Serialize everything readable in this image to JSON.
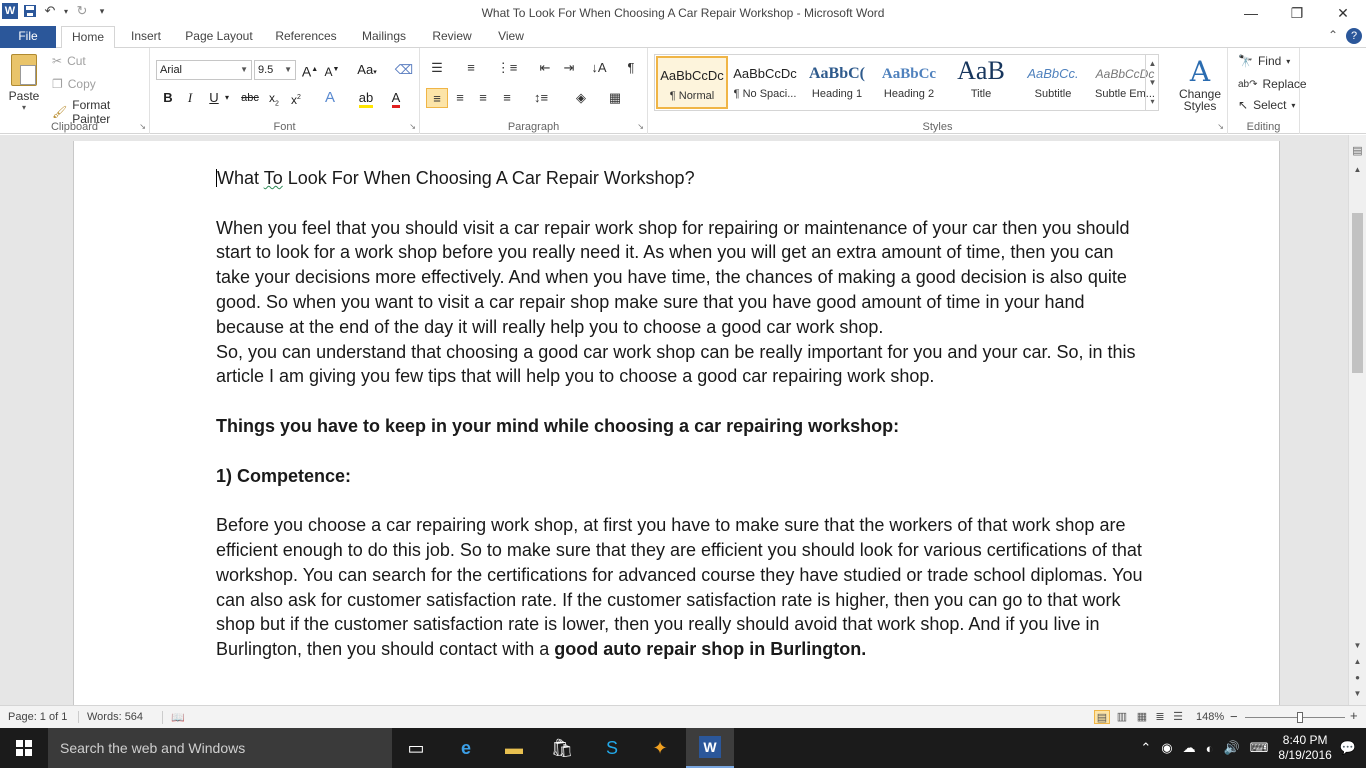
{
  "window": {
    "title": "What To Look For When Choosing A Car Repair Workshop  -  Microsoft Word",
    "app_icon": "W"
  },
  "ribbon_tabs": [
    "File",
    "Home",
    "Insert",
    "Page Layout",
    "References",
    "Mailings",
    "Review",
    "View"
  ],
  "active_tab": "Home",
  "clipboard": {
    "paste": "Paste",
    "cut": "Cut",
    "copy": "Copy",
    "format_painter": "Format Painter",
    "label": "Clipboard"
  },
  "font": {
    "name": "Arial",
    "size": "9.5",
    "label": "Font"
  },
  "paragraph": {
    "label": "Paragraph"
  },
  "styles": {
    "items": [
      {
        "sample": "AaBbCcDc",
        "name": "¶ Normal"
      },
      {
        "sample": "AaBbCcDc",
        "name": "¶ No Spaci..."
      },
      {
        "sample": "AaBbC(",
        "name": "Heading 1"
      },
      {
        "sample": "AaBbCc",
        "name": "Heading 2"
      },
      {
        "sample": "AaB",
        "name": "Title"
      },
      {
        "sample": "AaBbCc.",
        "name": "Subtitle"
      },
      {
        "sample": "AaBbCcDc",
        "name": "Subtle Em..."
      }
    ],
    "change_styles": "Change Styles",
    "label": "Styles"
  },
  "editing": {
    "find": "Find",
    "replace": "Replace",
    "select": "Select",
    "label": "Editing"
  },
  "document": {
    "title_line": "What To Look For When Choosing A Car Repair Workshop?",
    "title_prefix": "What ",
    "title_squiggle": "To",
    "title_rest": " Look For When Choosing A Car Repair Workshop?",
    "para1": "When you feel that you should visit a car repair work shop for repairing or maintenance of your car then you should start to look for a work shop before you really need it. As when you will get an extra amount of time, then you can take your decisions more effectively.  And when you have time, the chances of making a good decision is also quite good. So when you want to visit a car repair shop make sure that you have good amount of time in your hand because at the end of the day it will really help you to choose a good car work shop.",
    "para2": "So, you can understand that choosing a good car work shop can be really important for you and your car. So, in this article I am giving you few tips that will help you to choose a good car repairing work shop.",
    "heading1": "Things you have to keep in your mind while choosing a car repairing workshop:",
    "heading2": "1) Competence:",
    "para3": "Before you choose a car repairing work shop, at first you have to make sure that the workers of that work shop are efficient enough to do this job. So to make sure that they are efficient you should look for various certifications of that workshop. You can search for the certifications for advanced course they have studied or trade school diplomas.  You can also ask for customer satisfaction rate. If the customer satisfaction rate is higher, then you can go to that work shop but if the customer satisfaction rate is lower, then you really should avoid that work shop. And if you live in Burlington, then you should contact with a ",
    "para3_bold": "good auto repair shop in Burlington."
  },
  "status": {
    "page": "Page: 1 of 1",
    "words": "Words: 564",
    "zoom": "148%",
    "zoom_minus": "−",
    "zoom_plus": "+"
  },
  "taskbar": {
    "search_placeholder": "Search the web and Windows",
    "time": "8:40 PM",
    "date": "8/19/2016"
  },
  "colors": {
    "word_blue": "#2b579a",
    "selected_style": "#f0b546",
    "taskbar": "#1b1b1b"
  }
}
